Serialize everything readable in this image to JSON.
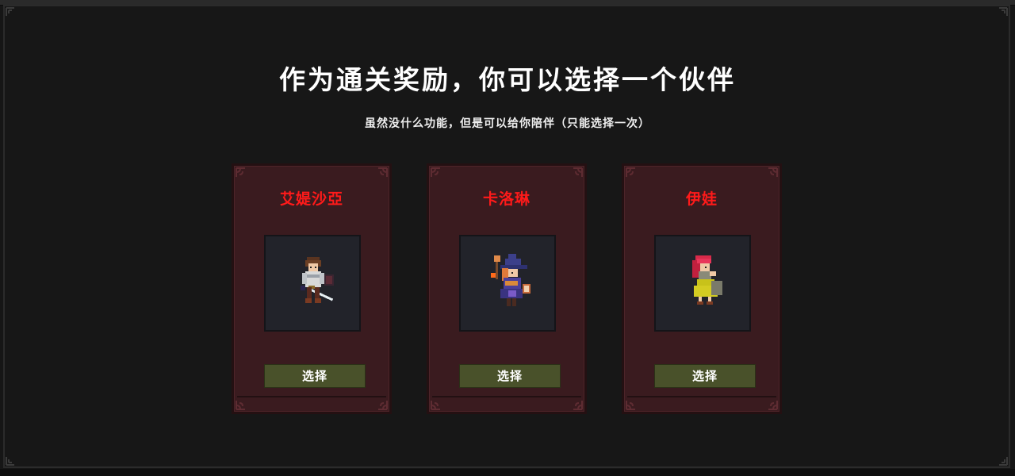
{
  "title": "作为通关奖励，你可以选择一个伙伴",
  "subtitle": "虽然没什么功能，但是可以给你陪伴（只能选择一次）",
  "colors": {
    "background": "#161616",
    "card_background": "#3a1b1f",
    "name_color": "#ff1a1a",
    "button_background": "#49512a",
    "portrait_background": "#22232a"
  },
  "companions": [
    {
      "name": "艾媞沙亞",
      "portrait_icon": "swordsman-sprite",
      "button_label": "选择"
    },
    {
      "name": "卡洛琳",
      "portrait_icon": "witch-sprite",
      "button_label": "选择"
    },
    {
      "name": "伊娃",
      "portrait_icon": "red-haired-girl-sprite",
      "button_label": "选择"
    }
  ]
}
